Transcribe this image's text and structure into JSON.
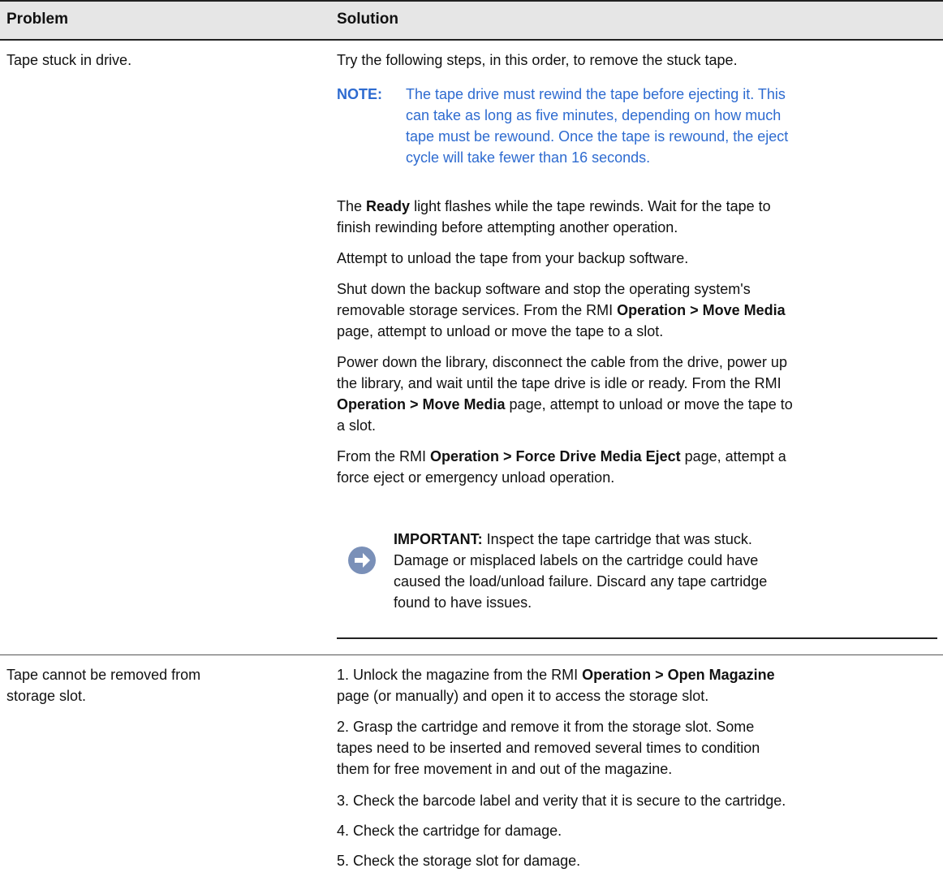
{
  "table": {
    "headers": {
      "problem": "Problem",
      "solution": "Solution"
    },
    "rows": [
      {
        "problem": "Tape stuck in drive.",
        "solution": {
          "intro": "Try the following steps, in this order, to remove the stuck tape.",
          "note_label": "NOTE:",
          "note_line1": "The tape drive must rewind the tape before ejecting it. This",
          "note_line2": "can take as long as five minutes, depending on how much",
          "note_line3": "tape must be rewound. Once the tape is rewound, the eject",
          "note_line4": "cycle will take fewer than 16 seconds.",
          "p1_pre": "The ",
          "p1_bold": "Ready",
          "p1_post": " light flashes while the tape rewinds. Wait for the tape to",
          "p1_line2": "finish rewinding before attempting another operation.",
          "p2": "Attempt to unload the tape from your backup software.",
          "p3_line1": "Shut down the backup software and stop the operating system's",
          "p3_line2_pre": "removable storage services. From the RMI ",
          "p3_line2_bold": "Operation > Move Media",
          "p3_line3": "page, attempt to unload or move the tape to a slot.",
          "p4_line1": "Power down the library, disconnect the cable from the drive, power up",
          "p4_line2": "the library, and wait until the tape drive is idle or ready. From the RMI",
          "p4_line3_bold": "Operation > Move Media",
          "p4_line3_post": " page, attempt to unload or move the tape to",
          "p4_line4": "a slot.",
          "p5_line1_pre": "From the RMI ",
          "p5_line1_bold": "Operation > Force Drive Media Eject",
          "p5_line1_post": " page, attempt a",
          "p5_line2": "force eject or emergency unload operation.",
          "important_label": "IMPORTANT:",
          "important_line1_post": "  Inspect the tape cartridge that was stuck.",
          "important_line2": "Damage or misplaced labels on the cartridge could have",
          "important_line3": "caused the load/unload failure. Discard any tape cartridge",
          "important_line4": "found to have issues."
        }
      },
      {
        "problem_line1": "Tape cannot be removed from",
        "problem_line2": "storage slot.",
        "solution": {
          "s1_pre": "1. Unlock the magazine from the RMI ",
          "s1_bold": "Operation > Open Magazine",
          "s1_line2": "page (or manually) and open it to access the storage slot.",
          "s2_line1": "2. Grasp the cartridge and remove it from the storage slot. Some",
          "s2_line2": "tapes need to be inserted and removed several times to condition",
          "s2_line3": "them for free movement in and out of the magazine.",
          "s3": "3. Check the barcode label and verity that it is secure to the cartridge.",
          "s4": "4. Check the cartridge for damage.",
          "s5": "5. Check the storage slot for damage."
        }
      }
    ]
  },
  "icons": {
    "important": "arrow-right-circle-icon"
  },
  "colors": {
    "note": "#2e6bd0",
    "header_bg": "#e6e6e6",
    "icon": "#7a90b8"
  }
}
